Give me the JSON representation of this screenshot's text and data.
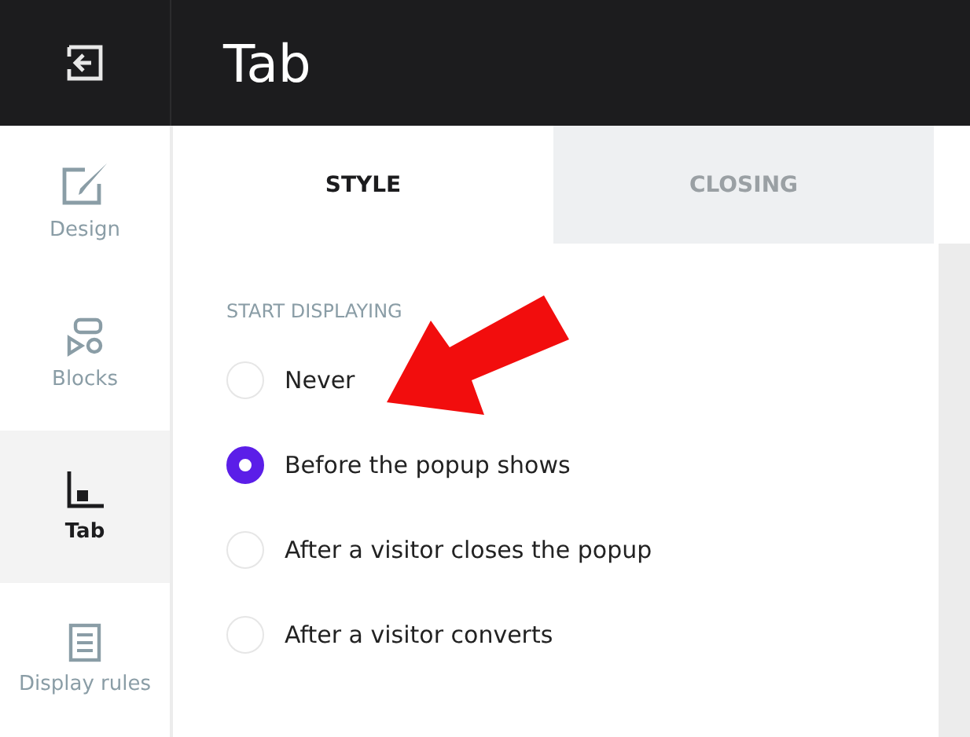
{
  "header": {
    "title": "Tab"
  },
  "sidebar": {
    "items": [
      {
        "label": "Design",
        "selected": false
      },
      {
        "label": "Blocks",
        "selected": false
      },
      {
        "label": "Tab",
        "selected": true
      },
      {
        "label": "Display rules",
        "selected": false
      }
    ]
  },
  "tabs": [
    {
      "label": "STYLE",
      "selected": true
    },
    {
      "label": "CLOSING",
      "selected": false
    }
  ],
  "section": {
    "heading": "START DISPLAYING",
    "options": [
      {
        "label": "Never",
        "selected": false
      },
      {
        "label": "Before the popup shows",
        "selected": true
      },
      {
        "label": "After a visitor closes the popup",
        "selected": false
      },
      {
        "label": "After a visitor converts",
        "selected": false
      }
    ]
  }
}
